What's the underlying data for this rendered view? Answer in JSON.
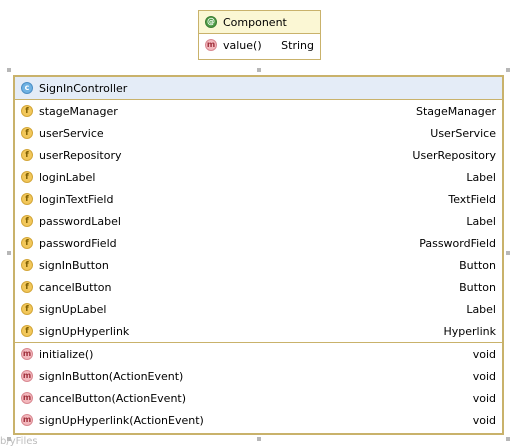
{
  "component": {
    "title": "Component",
    "title_icon": "annotation-icon",
    "method": {
      "name": "value()",
      "type": "String",
      "icon": "method-icon"
    }
  },
  "controller": {
    "title": "SignInController",
    "title_icon": "class-icon",
    "fields": [
      {
        "name": "stageManager",
        "type": "StageManager"
      },
      {
        "name": "userService",
        "type": "UserService"
      },
      {
        "name": "userRepository",
        "type": "UserRepository"
      },
      {
        "name": "loginLabel",
        "type": "Label"
      },
      {
        "name": "loginTextField",
        "type": "TextField"
      },
      {
        "name": "passwordLabel",
        "type": "Label"
      },
      {
        "name": "passwordField",
        "type": "PasswordField"
      },
      {
        "name": "signInButton",
        "type": "Button"
      },
      {
        "name": "cancelButton",
        "type": "Button"
      },
      {
        "name": "signUpLabel",
        "type": "Label"
      },
      {
        "name": "signUpHyperlink",
        "type": "Hyperlink"
      }
    ],
    "methods": [
      {
        "name": "initialize()",
        "type": "void"
      },
      {
        "name": "signInButton(ActionEvent)",
        "type": "void"
      },
      {
        "name": "cancelButton(ActionEvent)",
        "type": "void"
      },
      {
        "name": "signUpHyperlink(ActionEvent)",
        "type": "void"
      }
    ]
  },
  "icons": {
    "annotation": "@",
    "class": "c",
    "field": "f",
    "method": "m"
  },
  "colors": {
    "border": "#c9b26b",
    "annotation_header": "#fbf7d4",
    "class_header": "#e4ecf7",
    "field_icon": "#f2c75a",
    "method_icon": "#f3b8bd",
    "class_icon": "#6fb2e3",
    "annotation_icon": "#4e9b45"
  },
  "watermark": "b/yFiles"
}
